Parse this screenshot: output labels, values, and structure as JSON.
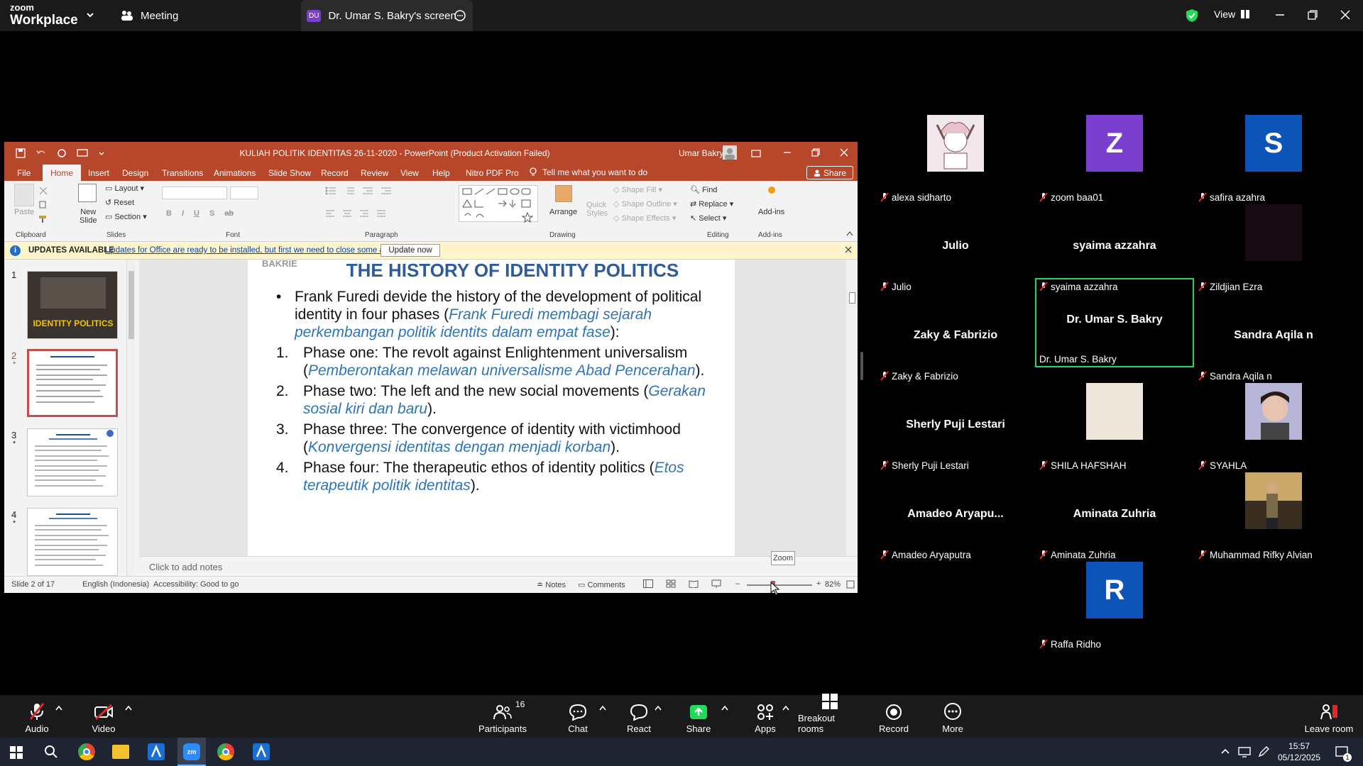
{
  "zoom": {
    "brand_top": "zoom",
    "brand_bottom": "Workplace",
    "tabs": [
      {
        "label": "Meeting"
      },
      {
        "label": "Dr. Umar S. Bakry's screen",
        "badge": "DU"
      }
    ],
    "view_label": "View",
    "accent_green": "#23d959"
  },
  "ppt": {
    "window_title": "KULIAH POLITIK IDENTITAS 26-11-2020  -  PowerPoint (Product Activation Failed)",
    "user": "Umar Bakry",
    "ribbon_tabs": [
      "File",
      "Home",
      "Insert",
      "Design",
      "Transitions",
      "Animations",
      "Slide Show",
      "Record",
      "Review",
      "View",
      "Help",
      "Nitro PDF Pro"
    ],
    "tell_me": "Tell me what you want to do",
    "share": "Share",
    "groups": {
      "clipboard": "Clipboard",
      "slides": "Slides",
      "font": "Font",
      "paragraph": "Paragraph",
      "drawing": "Drawing",
      "editing": "Editing",
      "addins": "Add-ins"
    },
    "buttons": {
      "paste": "Paste",
      "new_slide_1": "New",
      "new_slide_2": "Slide",
      "layout": "Layout",
      "reset": "Reset",
      "section": "Section",
      "arrange": "Arrange",
      "quick_styles_1": "Quick",
      "quick_styles_2": "Styles",
      "shape_fill": "Shape Fill",
      "shape_outline": "Shape Outline",
      "shape_effects": "Shape Effects",
      "find": "Find",
      "replace": "Replace",
      "select": "Select",
      "addins": "Add-ins"
    },
    "update_bar": {
      "label": "UPDATES AVAILABLE",
      "message": "Updates for Office are ready to be installed, but first we need to close some apps.",
      "button": "Update now"
    },
    "thumbnails": [
      "1",
      "2",
      "3",
      "4"
    ],
    "thumb1_text": "IDENTITY POLITICS",
    "slide": {
      "corner": "BAKRIE",
      "title": "THE HISTORY OF IDENTITY POLITICS",
      "bullet_en": "Frank Furedi devide the history of the development of political identity in four phases (",
      "bullet_id": "Frank Furedi membagi sejarah perkembangan politik identits dalam empat fase",
      "bullet_end": "):",
      "phases": [
        {
          "num": "1.",
          "en": "Phase one: The revolt against Enlightenment universalism (",
          "id": "Pemberontakan melawan universalisme Abad Pencerahan",
          "end": ")."
        },
        {
          "num": "2.",
          "en": "Phase two: The left and the new social movements (",
          "id": "Gerakan sosial kiri dan baru",
          "end": ")."
        },
        {
          "num": "3.",
          "en": "Phase three: The convergence of identity with victimhood (",
          "id": "Konvergensi identitas dengan menjadi korban",
          "end": ")."
        },
        {
          "num": "4.",
          "en": "Phase four: The therapeutic ethos of identity politics (",
          "id": "Etos terapeutik politik identitas",
          "end": ")."
        }
      ]
    },
    "notes_placeholder": "Click to add notes",
    "status": {
      "slide": "Slide 2 of 17",
      "language": "English (Indonesia)",
      "accessibility": "Accessibility: Good to go",
      "notes": "Notes",
      "comments": "Comments",
      "zoom": "82%",
      "zoom_tooltip": "Zoom"
    }
  },
  "participants": [
    {
      "label": "alexa sidharto",
      "kind": "photo-cartoon"
    },
    {
      "label": "zoom baa01",
      "kind": "avatar",
      "letter": "Z",
      "color": "#7a3fcf"
    },
    {
      "label": "safira azahra",
      "kind": "avatar",
      "letter": "S",
      "color": "#0c54b7"
    },
    {
      "label": "Julio",
      "kind": "name",
      "name": "Julio"
    },
    {
      "label": "syaima azzahra",
      "kind": "name",
      "name": "syaima azzahra"
    },
    {
      "label": "Zildjian Ezra",
      "kind": "dark"
    },
    {
      "label": "Zaky & Fabrizio",
      "kind": "name",
      "name": "Zaky & Fabrizio"
    },
    {
      "label": "Dr. Umar S. Bakry",
      "kind": "name",
      "name": "Dr. Umar S. Bakry",
      "active": true
    },
    {
      "label": "Sandra Aqila n",
      "kind": "name",
      "name": "Sandra Aqila n"
    },
    {
      "label": "Sherly Puji Lestari",
      "kind": "name",
      "name": "Sherly Puji Lestari"
    },
    {
      "label": "SHILA HAFSHAH",
      "kind": "beige"
    },
    {
      "label": "SYAHLA",
      "kind": "photo-person"
    },
    {
      "label": "Amadeo Aryaputra",
      "kind": "name",
      "name": "Amadeo  Aryapu..."
    },
    {
      "label": "Aminata Zuhria",
      "kind": "name",
      "name": "Aminata Zuhria"
    },
    {
      "label": "Muhammad Rifky Alvian",
      "kind": "photo-room"
    },
    {
      "label": "Raffa Ridho",
      "kind": "avatar",
      "letter": "R",
      "color": "#0c54b7"
    }
  ],
  "toolbar": {
    "audio": "Audio",
    "video": "Video",
    "participants": "Participants",
    "participants_count": "16",
    "chat": "Chat",
    "react": "React",
    "share": "Share",
    "apps": "Apps",
    "breakout": "Breakout rooms",
    "record": "Record",
    "more": "More",
    "leave": "Leave room"
  },
  "taskbar": {
    "time": "15:57",
    "date": "05/12/2025",
    "notif_count": "1"
  }
}
